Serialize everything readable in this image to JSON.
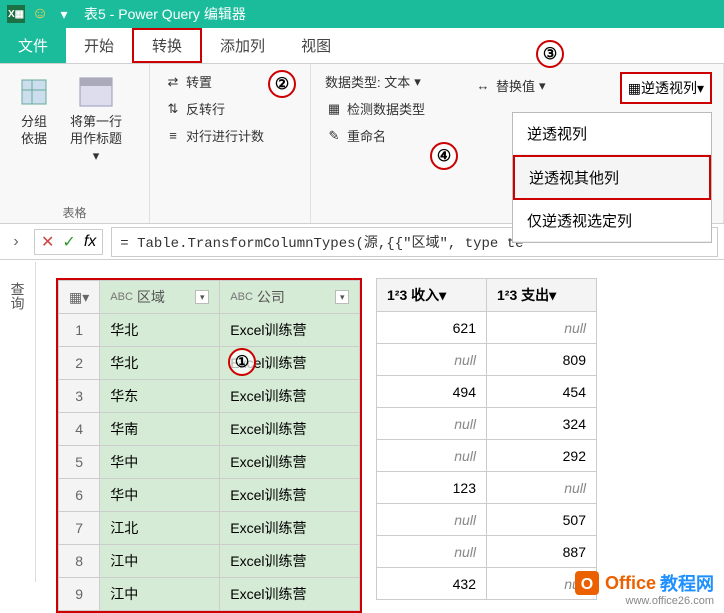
{
  "titlebar": {
    "app_prefix": "表5 - ",
    "app_name": "Power Query 编辑器"
  },
  "menu": {
    "file": "文件",
    "home": "开始",
    "transform": "转换",
    "addcol": "添加列",
    "view": "视图"
  },
  "ribbon": {
    "group_by": "分组\n依据",
    "first_row_header": "将第一行\n用作标题",
    "transpose": "转置",
    "reverse_rows": "反转行",
    "count_rows": "对行进行计数",
    "table_label": "表格",
    "datatype": "数据类型: 文本",
    "detect_type": "检测数据类型",
    "rename": "重命名",
    "replace": "替换值",
    "unpivot": "逆透视列"
  },
  "dropdown": {
    "item1": "逆透视列",
    "item2": "逆透视其他列",
    "item3": "仅逆透视选定列"
  },
  "callouts": {
    "c1": "①",
    "c2": "②",
    "c3": "③",
    "c4": "④"
  },
  "formula": {
    "fx": "fx",
    "text": "= Table.TransformColumnTypes(源,{{\"区域\", type te"
  },
  "querypanel": "查询",
  "columns": {
    "region_type": "ABC",
    "region": "区域",
    "company_type": "ABC",
    "company": "公司",
    "income_type": "1²3",
    "income": "收入",
    "expense_type": "1²3",
    "expense": "支出"
  },
  "rows": [
    {
      "n": "1",
      "region": "华北",
      "company": "Excel训练营",
      "income": "621",
      "expense": "null"
    },
    {
      "n": "2",
      "region": "华北",
      "company": "Excel训练营",
      "income": "null",
      "expense": "809"
    },
    {
      "n": "3",
      "region": "华东",
      "company": "Excel训练营",
      "income": "494",
      "expense": "454"
    },
    {
      "n": "4",
      "region": "华南",
      "company": "Excel训练营",
      "income": "null",
      "expense": "324"
    },
    {
      "n": "5",
      "region": "华中",
      "company": "Excel训练营",
      "income": "null",
      "expense": "292"
    },
    {
      "n": "6",
      "region": "华中",
      "company": "Excel训练营",
      "income": "123",
      "expense": "null"
    },
    {
      "n": "7",
      "region": "江北",
      "company": "Excel训练营",
      "income": "null",
      "expense": "507"
    },
    {
      "n": "8",
      "region": "江中",
      "company": "Excel训练营",
      "income": "null",
      "expense": "887"
    },
    {
      "n": "9",
      "region": "江中",
      "company": "Excel训练营",
      "income": "432",
      "expense": "null"
    }
  ],
  "watermark": {
    "text1": "Office",
    "text2": "教程网",
    "url": "www.office26.com"
  }
}
